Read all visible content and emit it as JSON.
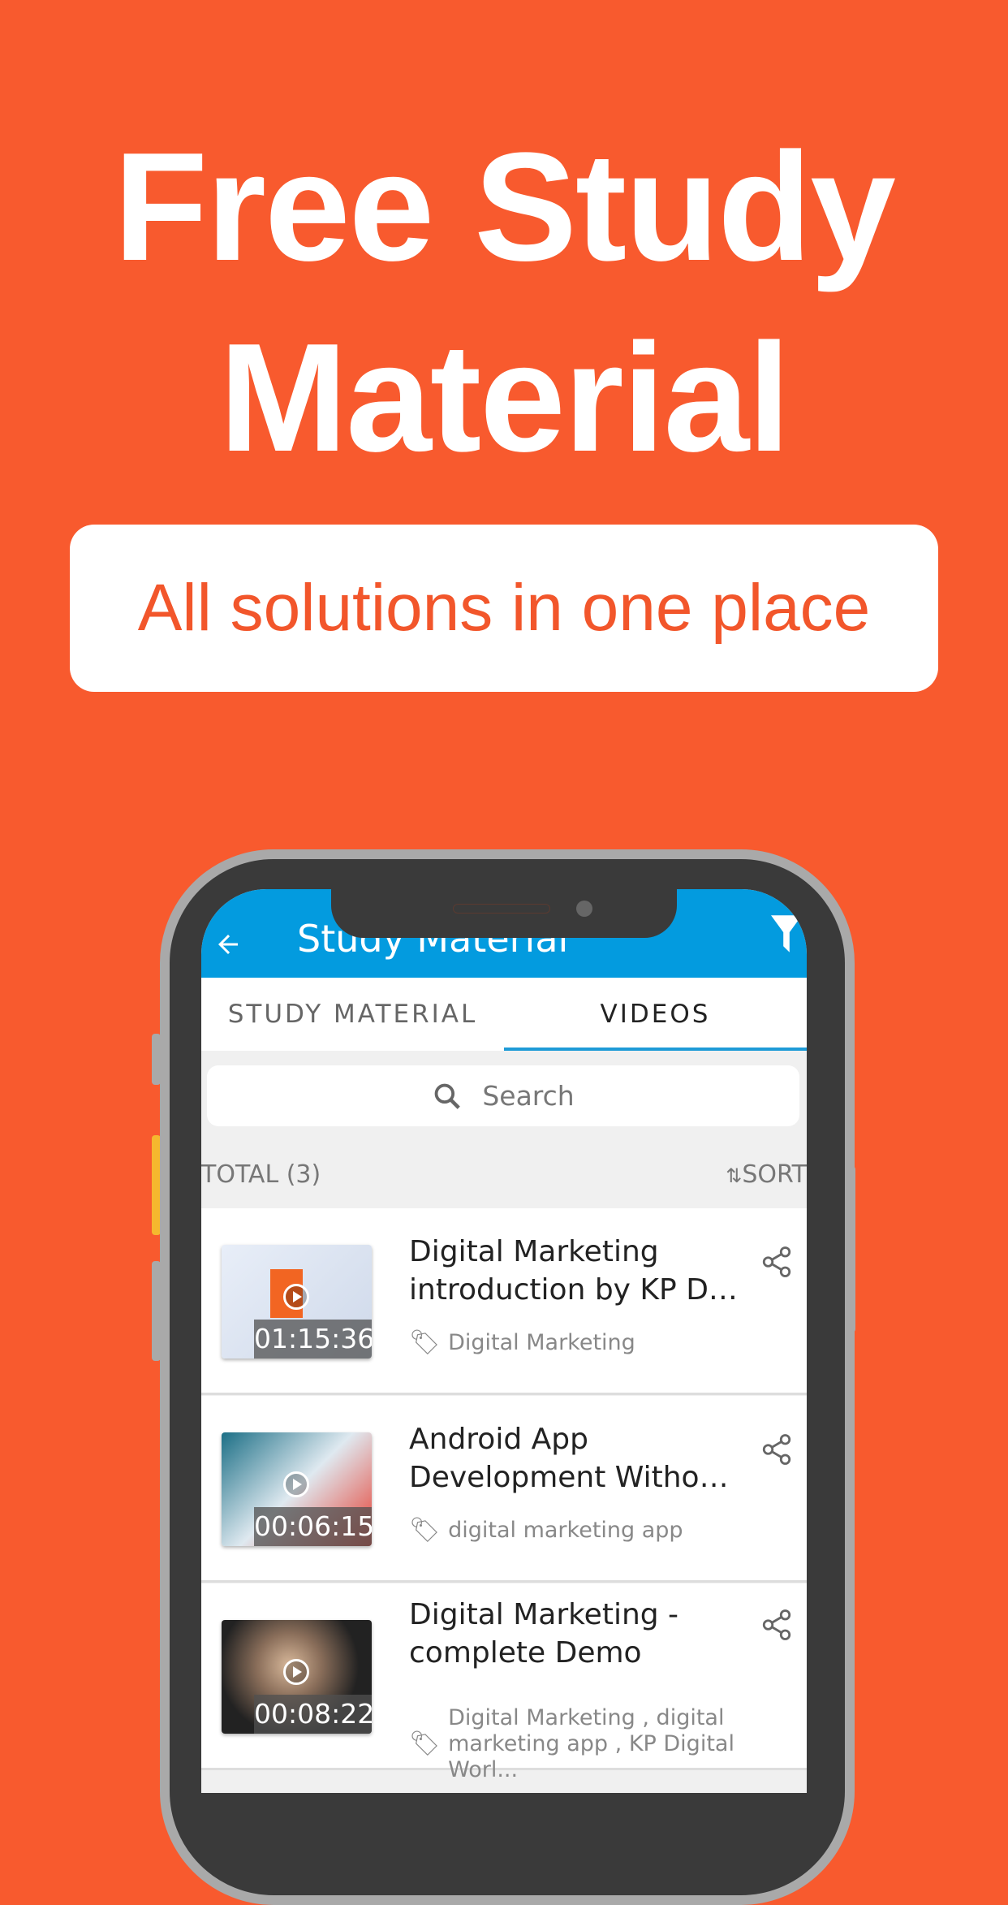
{
  "promo": {
    "headline_line1": "Free Study",
    "headline_line2": "Material",
    "tagline": "All solutions in one place"
  },
  "colors": {
    "background": "#F85A2E",
    "appbar": "#039BDF",
    "tab_indicator": "#1E9BD7"
  },
  "app": {
    "title": "Study Material",
    "back_icon": "arrow-left-icon",
    "filter_icon": "filter-icon",
    "tabs": [
      {
        "label": "STUDY MATERIAL",
        "active": false
      },
      {
        "label": "VIDEOS",
        "active": true
      }
    ],
    "search": {
      "placeholder": "Search"
    },
    "total_label": "TOTAL (3)",
    "sort_label": "SORT",
    "videos": [
      {
        "title_line1": "Digital Marketing",
        "title_line2": "introduction by KP Di...",
        "duration": "01:15:36",
        "tags_line1": "Digital Marketing",
        "tags_line2": ""
      },
      {
        "title_line1": "Android App",
        "title_line2": "Development Withou...",
        "duration": "00:06:15",
        "tags_line1": "digital marketing app",
        "tags_line2": ""
      },
      {
        "title_line1": "Digital Marketing -",
        "title_line2": "complete Demo",
        "duration": "00:08:22",
        "tags_line1": "Digital Marketing , digital",
        "tags_line2": "marketing app , KP Digital Worl..."
      }
    ]
  }
}
